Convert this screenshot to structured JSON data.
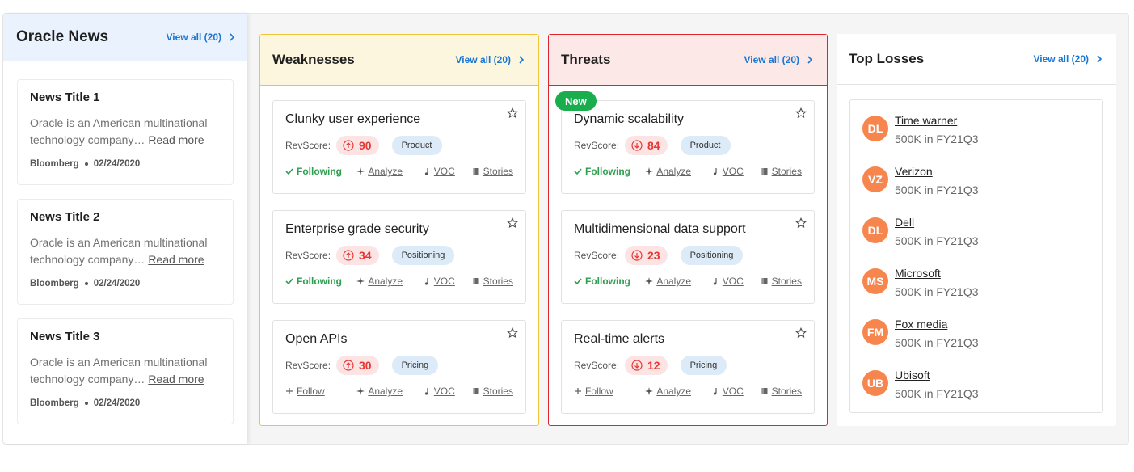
{
  "oracle_news": {
    "title": "Oracle News",
    "view_all": "View all (20)",
    "items": [
      {
        "title": "News Title 1",
        "body": "Oracle is an American multinational technology company…",
        "read_more": "Read more",
        "source": "Bloomberg",
        "date": "02/24/2020"
      },
      {
        "title": "News Title 2",
        "body": "Oracle is an American multinational technology company…",
        "read_more": "Read more",
        "source": "Bloomberg",
        "date": "02/24/2020"
      },
      {
        "title": "News Title 3",
        "body": "Oracle is an American multinational technology company…",
        "read_more": "Read more",
        "source": "Bloomberg",
        "date": "02/24/2020"
      }
    ]
  },
  "weaknesses": {
    "title": "Weaknesses",
    "view_all": "View all (20)",
    "cards": [
      {
        "title": "Clunky user experience",
        "rev_label": "RevScore:",
        "score": "90",
        "tag": "Product",
        "follow": "Following",
        "analyze": "Analyze",
        "voc": "VOC",
        "stories": "Stories"
      },
      {
        "title": "Enterprise grade security",
        "rev_label": "RevScore:",
        "score": "34",
        "tag": "Positioning",
        "follow": "Following",
        "analyze": "Analyze",
        "voc": "VOC",
        "stories": "Stories"
      },
      {
        "title": "Open APIs",
        "rev_label": "RevScore:",
        "score": "30",
        "tag": "Pricing",
        "follow": "Follow",
        "analyze": "Analyze",
        "voc": "VOC",
        "stories": "Stories"
      }
    ]
  },
  "threats": {
    "title": "Threats",
    "view_all": "View all (20)",
    "new_badge": "New",
    "cards": [
      {
        "title": "Dynamic scalability",
        "rev_label": "RevScore:",
        "score": "84",
        "tag": "Product",
        "follow": "Following",
        "analyze": "Analyze",
        "voc": "VOC",
        "stories": "Stories"
      },
      {
        "title": "Multidimensional data support",
        "rev_label": "RevScore:",
        "score": "23",
        "tag": "Positioning",
        "follow": "Following",
        "analyze": "Analyze",
        "voc": "VOC",
        "stories": "Stories"
      },
      {
        "title": "Real-time alerts",
        "rev_label": "RevScore:",
        "score": "12",
        "tag": "Pricing",
        "follow": "Follow",
        "analyze": "Analyze",
        "voc": "VOC",
        "stories": "Stories"
      }
    ]
  },
  "top_losses": {
    "title": "Top Losses",
    "view_all": "View all (20)",
    "items": [
      {
        "initials": "DL",
        "name": "Time warner",
        "amount": "500K in FY21Q3"
      },
      {
        "initials": "VZ",
        "name": "Verizon",
        "amount": "500K in FY21Q3"
      },
      {
        "initials": "DL",
        "name": "Dell",
        "amount": "500K in FY21Q3"
      },
      {
        "initials": "MS",
        "name": "Microsoft",
        "amount": "500K in FY21Q3"
      },
      {
        "initials": "FM",
        "name": "Fox media",
        "amount": "500K in FY21Q3"
      },
      {
        "initials": "UB",
        "name": "Ubisoft",
        "amount": "500K in FY21Q3"
      }
    ]
  },
  "colors": {
    "accent_link": "#1976d2",
    "weakness_border": "#efc63a",
    "threat_border": "#e0242e",
    "score_red": "#e53935",
    "following_green": "#2e9e4f",
    "new_badge": "#1aad4e",
    "avatar_orange": "#f7864e"
  },
  "icons": [
    "chevron-right-icon",
    "star-icon",
    "arrow-up-circle-icon",
    "arrow-down-circle-icon",
    "check-icon",
    "plus-icon",
    "sparkle-icon",
    "music-note-icon",
    "book-icon"
  ]
}
